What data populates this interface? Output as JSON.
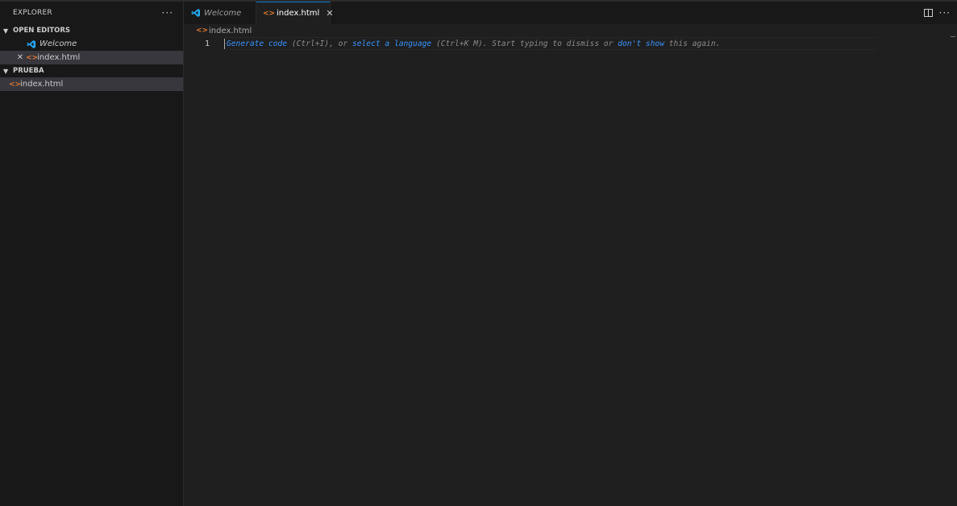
{
  "sidebar": {
    "title": "EXPLORER",
    "more": "···",
    "open_editors": {
      "title": "OPEN EDITORS",
      "items": [
        {
          "label": "Welcome"
        },
        {
          "label": "index.html",
          "close": "✕"
        }
      ]
    },
    "folder": {
      "title": "PRUEBA",
      "items": [
        {
          "label": "index.html"
        }
      ]
    }
  },
  "tabs": [
    {
      "label": "Welcome"
    },
    {
      "label": "index.html",
      "close": "✕"
    }
  ],
  "editor_more": "···",
  "breadcrumb": {
    "file": "index.html"
  },
  "editor": {
    "line_number": "1",
    "hint": {
      "generate": "Generate code",
      "t1": " (Ctrl+I), or ",
      "select": "select a language",
      "t2": " (Ctrl+K M). Start typing to dismiss or ",
      "dontshow": "don't show",
      "t3": " this again."
    }
  },
  "colors": {
    "accent": "#0078d4",
    "html_icon": "#e37933",
    "link": "#3794ff",
    "vscode_blue": "#23a9f2"
  },
  "icons": {
    "html_file": "<>",
    "chevron": "chevron-down-icon"
  }
}
